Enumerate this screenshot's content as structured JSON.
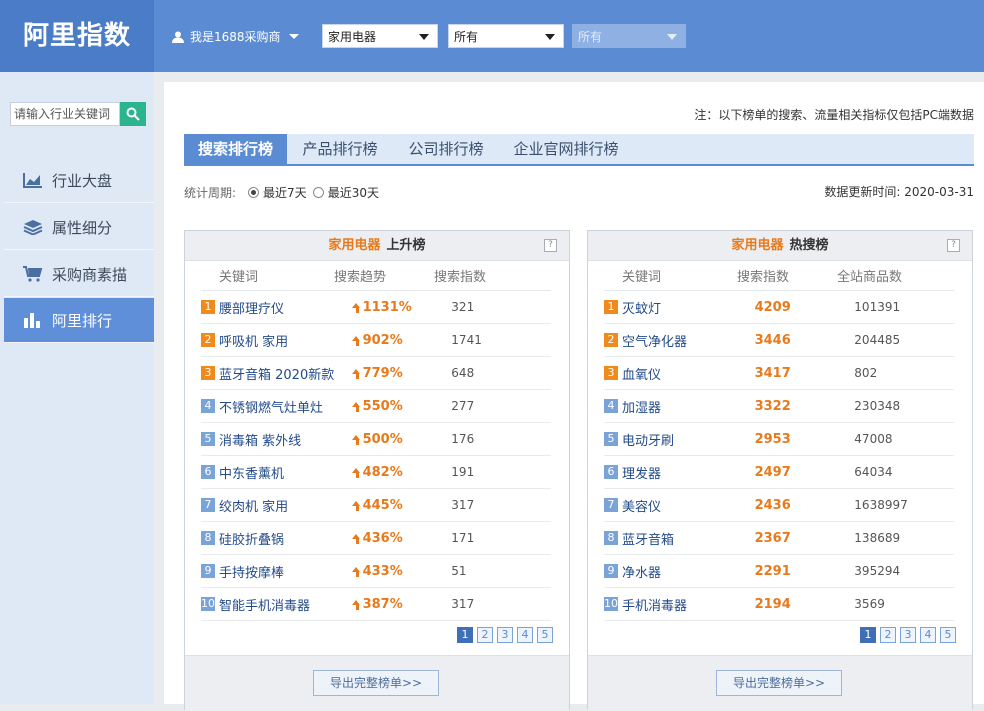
{
  "header": {
    "logo": "阿里指数",
    "user_label": "我是1688采购商",
    "select1": "家用电器",
    "select2": "所有",
    "select3": "所有"
  },
  "sidebar": {
    "search_placeholder": "请输入行业关键词",
    "items": [
      {
        "label": "行业大盘",
        "icon": "chart-area-icon"
      },
      {
        "label": "属性细分",
        "icon": "layers-icon"
      },
      {
        "label": "采购商素描",
        "icon": "cart-icon"
      },
      {
        "label": "阿里排行",
        "icon": "bar-chart-icon"
      }
    ],
    "active_index": 3
  },
  "main": {
    "note": "注：以下榜单的搜索、流量相关指标仅包括PC端数据",
    "tabs": [
      "搜索排行榜",
      "产品排行榜",
      "公司排行榜",
      "企业官网排行榜"
    ],
    "active_tab": 0,
    "period_label": "统计周期:",
    "period_options": [
      "最近7天",
      "最近30天"
    ],
    "period_selected": 0,
    "update_time": "数据更新时间: 2020-03-31"
  },
  "rising": {
    "category": "家用电器",
    "title": "上升榜",
    "columns": [
      "关键词",
      "搜索趋势",
      "搜索指数"
    ],
    "rows": [
      {
        "rank": "1",
        "keyword": "腰部理疗仪",
        "trend": "1131%",
        "index": "321"
      },
      {
        "rank": "2",
        "keyword": "呼吸机 家用",
        "trend": "902%",
        "index": "1741"
      },
      {
        "rank": "3",
        "keyword": "蓝牙音箱 2020新款",
        "trend": "779%",
        "index": "648"
      },
      {
        "rank": "4",
        "keyword": "不锈钢燃气灶单灶",
        "trend": "550%",
        "index": "277"
      },
      {
        "rank": "5",
        "keyword": "消毒箱 紫外线",
        "trend": "500%",
        "index": "176"
      },
      {
        "rank": "6",
        "keyword": "中东香薰机",
        "trend": "482%",
        "index": "191"
      },
      {
        "rank": "7",
        "keyword": "绞肉机 家用",
        "trend": "445%",
        "index": "317"
      },
      {
        "rank": "8",
        "keyword": "硅胶折叠锅",
        "trend": "436%",
        "index": "171"
      },
      {
        "rank": "9",
        "keyword": "手持按摩棒",
        "trend": "433%",
        "index": "51"
      },
      {
        "rank": "10",
        "keyword": "智能手机消毒器",
        "trend": "387%",
        "index": "317"
      }
    ],
    "pages": [
      "1",
      "2",
      "3",
      "4",
      "5"
    ],
    "export_label": "导出完整榜单>>"
  },
  "hot": {
    "category": "家用电器",
    "title": "热搜榜",
    "columns": [
      "关键词",
      "搜索指数",
      "全站商品数"
    ],
    "rows": [
      {
        "rank": "1",
        "keyword": "灭蚊灯",
        "index": "4209",
        "count": "101391"
      },
      {
        "rank": "2",
        "keyword": "空气净化器",
        "index": "3446",
        "count": "204485"
      },
      {
        "rank": "3",
        "keyword": "血氧仪",
        "index": "3417",
        "count": "802"
      },
      {
        "rank": "4",
        "keyword": "加湿器",
        "index": "3322",
        "count": "230348"
      },
      {
        "rank": "5",
        "keyword": "电动牙刷",
        "index": "2953",
        "count": "47008"
      },
      {
        "rank": "6",
        "keyword": "理发器",
        "index": "2497",
        "count": "64034"
      },
      {
        "rank": "7",
        "keyword": "美容仪",
        "index": "2436",
        "count": "1638997"
      },
      {
        "rank": "8",
        "keyword": "蓝牙音箱",
        "index": "2367",
        "count": "138689"
      },
      {
        "rank": "9",
        "keyword": "净水器",
        "index": "2291",
        "count": "395294"
      },
      {
        "rank": "10",
        "keyword": "手机消毒器",
        "index": "2194",
        "count": "3569"
      }
    ],
    "pages": [
      "1",
      "2",
      "3",
      "4",
      "5"
    ],
    "export_label": "导出完整榜单>>"
  },
  "colors": {
    "brand": "#5b8bd2",
    "accent": "#e87a1b",
    "rank_top": "#f08a1c",
    "rank_rest": "#7aa3d8"
  }
}
